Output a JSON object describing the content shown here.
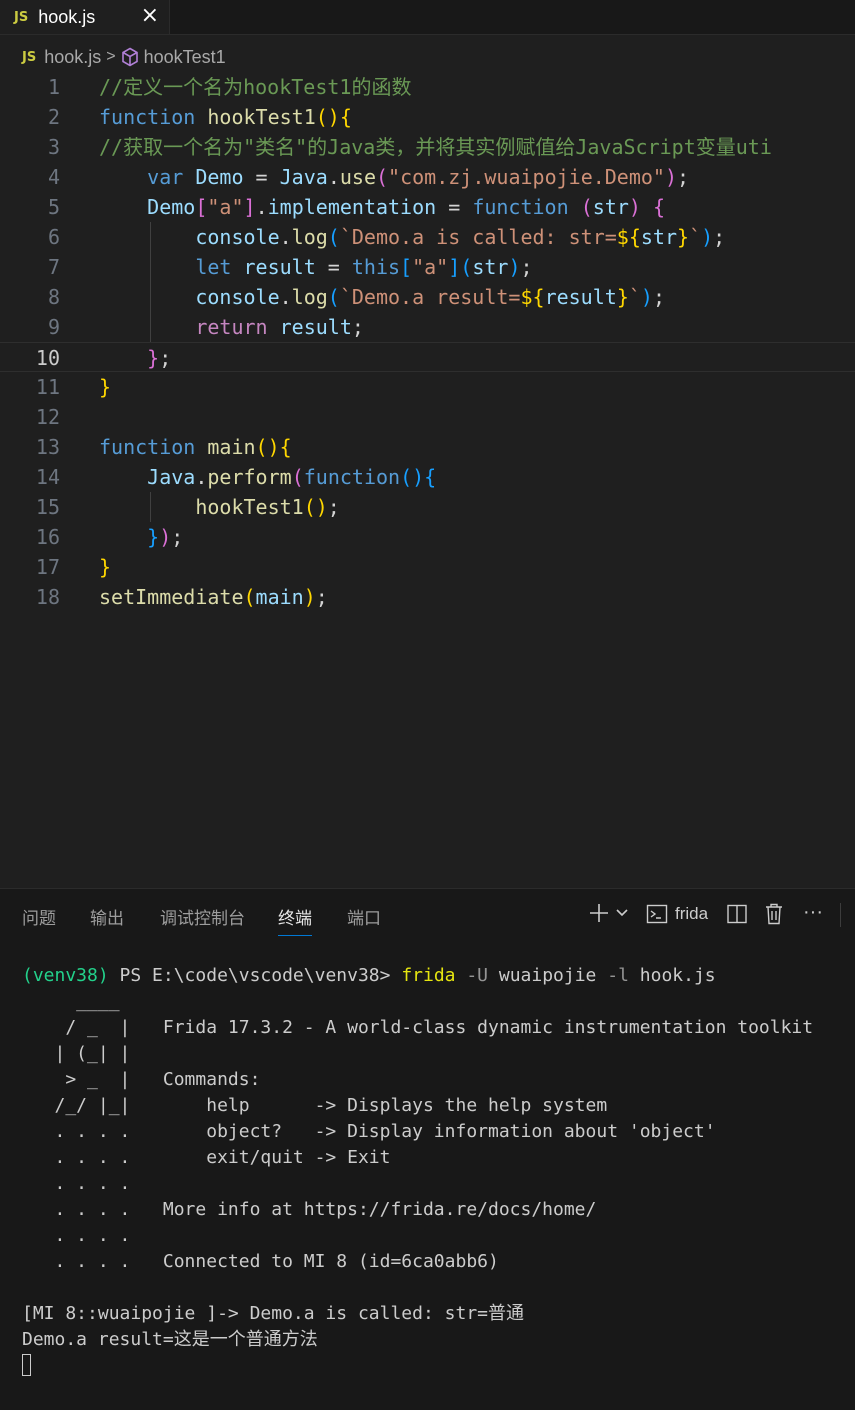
{
  "editor_tab": {
    "badge": "JS",
    "label": "hook.js",
    "close": "×"
  },
  "breadcrumb": {
    "badge": "JS",
    "file": "hook.js",
    "separator": ">",
    "symbol": "hookTest1"
  },
  "code_lines": [
    [
      {
        "t": "//定义一个名为hookTest1的函数",
        "c": "c-comment"
      }
    ],
    [
      {
        "t": "function",
        "c": "c-kw"
      },
      {
        "t": " ",
        "c": "c-def"
      },
      {
        "t": "hookTest1",
        "c": "c-fn"
      },
      {
        "t": "()",
        "c": "c-b1"
      },
      {
        "t": "{",
        "c": "c-b1"
      }
    ],
    [
      {
        "t": "//获取一个名为\"类名\"的Java类，并将其实例赋值给JavaScript变量uti",
        "c": "c-comment"
      }
    ],
    [
      {
        "t": "    ",
        "c": "c-def"
      },
      {
        "t": "var",
        "c": "c-kw"
      },
      {
        "t": " ",
        "c": "c-def"
      },
      {
        "t": "Demo",
        "c": "c-var"
      },
      {
        "t": " = ",
        "c": "c-def"
      },
      {
        "t": "Java",
        "c": "c-var"
      },
      {
        "t": ".",
        "c": "c-def"
      },
      {
        "t": "use",
        "c": "c-fn"
      },
      {
        "t": "(",
        "c": "c-b2"
      },
      {
        "t": "\"com.zj.wuaipojie.Demo\"",
        "c": "c-str"
      },
      {
        "t": ")",
        "c": "c-b2"
      },
      {
        "t": ";",
        "c": "c-def"
      }
    ],
    [
      {
        "t": "    ",
        "c": "c-def"
      },
      {
        "t": "Demo",
        "c": "c-var"
      },
      {
        "t": "[",
        "c": "c-b2"
      },
      {
        "t": "\"a\"",
        "c": "c-str"
      },
      {
        "t": "]",
        "c": "c-b2"
      },
      {
        "t": ".",
        "c": "c-def"
      },
      {
        "t": "implementation",
        "c": "c-var"
      },
      {
        "t": " = ",
        "c": "c-def"
      },
      {
        "t": "function",
        "c": "c-kw"
      },
      {
        "t": " ",
        "c": "c-def"
      },
      {
        "t": "(",
        "c": "c-b2"
      },
      {
        "t": "str",
        "c": "c-var"
      },
      {
        "t": ")",
        "c": "c-b2"
      },
      {
        "t": " ",
        "c": "c-def"
      },
      {
        "t": "{",
        "c": "c-b2"
      }
    ],
    [
      {
        "t": "        ",
        "c": "c-def"
      },
      {
        "t": "console",
        "c": "c-var"
      },
      {
        "t": ".",
        "c": "c-def"
      },
      {
        "t": "log",
        "c": "c-fn"
      },
      {
        "t": "(",
        "c": "c-b3"
      },
      {
        "t": "`Demo.a is called: str=",
        "c": "c-str"
      },
      {
        "t": "${",
        "c": "c-b1"
      },
      {
        "t": "str",
        "c": "c-var"
      },
      {
        "t": "}",
        "c": "c-b1"
      },
      {
        "t": "`",
        "c": "c-str"
      },
      {
        "t": ")",
        "c": "c-b3"
      },
      {
        "t": ";",
        "c": "c-def"
      }
    ],
    [
      {
        "t": "        ",
        "c": "c-def"
      },
      {
        "t": "let",
        "c": "c-kw"
      },
      {
        "t": " ",
        "c": "c-def"
      },
      {
        "t": "result",
        "c": "c-var"
      },
      {
        "t": " = ",
        "c": "c-def"
      },
      {
        "t": "this",
        "c": "c-kw"
      },
      {
        "t": "[",
        "c": "c-b3"
      },
      {
        "t": "\"a\"",
        "c": "c-str"
      },
      {
        "t": "]",
        "c": "c-b3"
      },
      {
        "t": "(",
        "c": "c-b3"
      },
      {
        "t": "str",
        "c": "c-var"
      },
      {
        "t": ")",
        "c": "c-b3"
      },
      {
        "t": ";",
        "c": "c-def"
      }
    ],
    [
      {
        "t": "        ",
        "c": "c-def"
      },
      {
        "t": "console",
        "c": "c-var"
      },
      {
        "t": ".",
        "c": "c-def"
      },
      {
        "t": "log",
        "c": "c-fn"
      },
      {
        "t": "(",
        "c": "c-b3"
      },
      {
        "t": "`Demo.a result=",
        "c": "c-str"
      },
      {
        "t": "${",
        "c": "c-b1"
      },
      {
        "t": "result",
        "c": "c-var"
      },
      {
        "t": "}",
        "c": "c-b1"
      },
      {
        "t": "`",
        "c": "c-str"
      },
      {
        "t": ")",
        "c": "c-b3"
      },
      {
        "t": ";",
        "c": "c-def"
      }
    ],
    [
      {
        "t": "        ",
        "c": "c-def"
      },
      {
        "t": "return",
        "c": "c-ctrl"
      },
      {
        "t": " ",
        "c": "c-def"
      },
      {
        "t": "result",
        "c": "c-var"
      },
      {
        "t": ";",
        "c": "c-def"
      }
    ],
    [
      {
        "t": "    ",
        "c": "c-def"
      },
      {
        "t": "}",
        "c": "c-b2"
      },
      {
        "t": ";",
        "c": "c-def"
      }
    ],
    [
      {
        "t": "}",
        "c": "c-b1"
      }
    ],
    [],
    [
      {
        "t": "function",
        "c": "c-kw"
      },
      {
        "t": " ",
        "c": "c-def"
      },
      {
        "t": "main",
        "c": "c-fn"
      },
      {
        "t": "()",
        "c": "c-b1"
      },
      {
        "t": "{",
        "c": "c-b1"
      }
    ],
    [
      {
        "t": "    ",
        "c": "c-def"
      },
      {
        "t": "Java",
        "c": "c-var"
      },
      {
        "t": ".",
        "c": "c-def"
      },
      {
        "t": "perform",
        "c": "c-fn"
      },
      {
        "t": "(",
        "c": "c-b2"
      },
      {
        "t": "function",
        "c": "c-kw"
      },
      {
        "t": "()",
        "c": "c-b3"
      },
      {
        "t": "{",
        "c": "c-b3"
      }
    ],
    [
      {
        "t": "        ",
        "c": "c-def"
      },
      {
        "t": "hookTest1",
        "c": "c-fn"
      },
      {
        "t": "()",
        "c": "c-b1"
      },
      {
        "t": ";",
        "c": "c-def"
      }
    ],
    [
      {
        "t": "    ",
        "c": "c-def"
      },
      {
        "t": "}",
        "c": "c-b3"
      },
      {
        "t": ")",
        "c": "c-b2"
      },
      {
        "t": ";",
        "c": "c-def"
      }
    ],
    [
      {
        "t": "}",
        "c": "c-b1"
      }
    ],
    [
      {
        "t": "setImmediate",
        "c": "c-fn"
      },
      {
        "t": "(",
        "c": "c-b1"
      },
      {
        "t": "main",
        "c": "c-var"
      },
      {
        "t": ")",
        "c": "c-b1"
      },
      {
        "t": ";",
        "c": "c-def"
      }
    ]
  ],
  "line_numbers": [
    "1",
    "2",
    "3",
    "4",
    "5",
    "6",
    "7",
    "8",
    "9",
    "10",
    "11",
    "12",
    "13",
    "14",
    "15",
    "16",
    "17",
    "18"
  ],
  "current_line": "10",
  "panel": {
    "tabs": [
      "问题",
      "输出",
      "调试控制台",
      "终端",
      "端口"
    ],
    "active_tab": "终端",
    "terminal_name": "frida",
    "more": "···"
  },
  "terminal_lines": [
    [
      {
        "t": "(venv38)",
        "c": "t-green"
      },
      {
        "t": " PS E:\\code\\vscode\\venv38> ",
        "c": ""
      },
      {
        "t": "frida",
        "c": "t-yellow"
      },
      {
        "t": " -U ",
        "c": "t-gray"
      },
      {
        "t": "wuaipojie",
        "c": ""
      },
      {
        "t": " -l ",
        "c": "t-gray"
      },
      {
        "t": "hook.js",
        "c": ""
      }
    ],
    [
      {
        "t": "     ____",
        "c": ""
      }
    ],
    [
      {
        "t": "    / _  |   Frida 17.3.2 - A world-class dynamic instrumentation toolkit",
        "c": ""
      }
    ],
    [
      {
        "t": "   | (_| |",
        "c": ""
      }
    ],
    [
      {
        "t": "    > _  |   Commands:",
        "c": ""
      }
    ],
    [
      {
        "t": "   /_/ |_|       help      -> Displays the help system",
        "c": ""
      }
    ],
    [
      {
        "t": "   . . . .       object?   -> Display information about 'object'",
        "c": ""
      }
    ],
    [
      {
        "t": "   . . . .       exit/quit -> Exit",
        "c": ""
      }
    ],
    [
      {
        "t": "   . . . .",
        "c": ""
      }
    ],
    [
      {
        "t": "   . . . .   More info at https://frida.re/docs/home/",
        "c": ""
      }
    ],
    [
      {
        "t": "   . . . .",
        "c": ""
      }
    ],
    [
      {
        "t": "   . . . .   Connected to MI 8 (id=6ca0abb6)",
        "c": ""
      }
    ],
    [],
    [
      {
        "t": "[MI 8::wuaipojie ]-> Demo.a is called: str=普通",
        "c": ""
      }
    ],
    [
      {
        "t": "Demo.a result=这是一个普通方法",
        "c": ""
      }
    ]
  ]
}
